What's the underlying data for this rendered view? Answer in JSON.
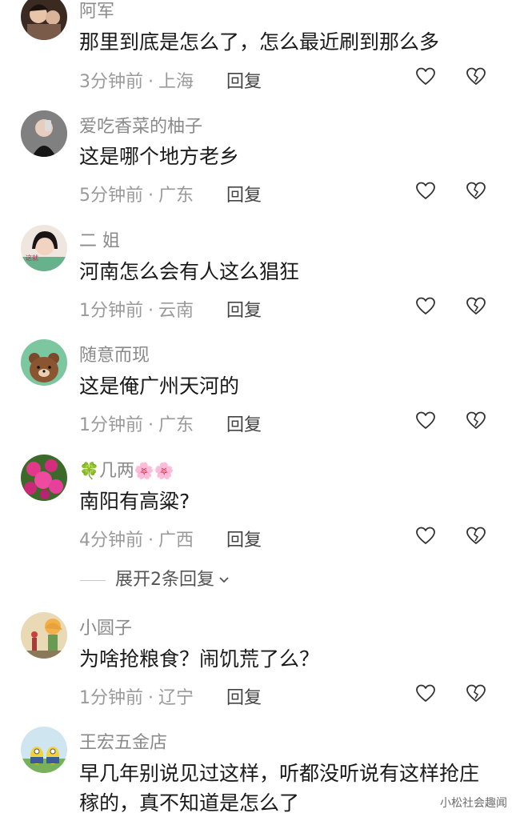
{
  "comments": [
    {
      "username": "阿军",
      "text": "那里到底是怎么了，怎么最近刷到那么多",
      "time": "3分钟前",
      "location": "上海",
      "reply_label": "回复"
    },
    {
      "username": "爱吃香菜的柚子",
      "text": "这是哪个地方老乡",
      "time": "5分钟前",
      "location": "广东",
      "reply_label": "回复"
    },
    {
      "username": "二  姐",
      "text": "河南怎么会有人这么猖狂",
      "time": "1分钟前",
      "location": "云南",
      "reply_label": "回复"
    },
    {
      "username": "随意而现",
      "text": "这是俺广州天河的",
      "time": "1分钟前",
      "location": "广东",
      "reply_label": "回复"
    },
    {
      "username": "几两",
      "text": "南阳有高粱?",
      "time": "4分钟前",
      "location": "广西",
      "reply_label": "回复"
    },
    {
      "username": "小圆子",
      "text": "为啥抢粮食？闹饥荒了么？",
      "time": "1分钟前",
      "location": "辽宁",
      "reply_label": "回复"
    },
    {
      "username": "王宏五金店",
      "text": "早几年别说见过这样，听都没听说有这样抢庄稼的，真不知道是怎么了",
      "time": "",
      "location": "",
      "reply_label": ""
    }
  ],
  "expand_replies_label": "展开2条回复",
  "separator_dot": "·",
  "emoji": {
    "clover": "🍀",
    "flower": "🌸"
  },
  "watermark": "小松社会趣闻",
  "colors": {
    "username": "#8a8a8a",
    "text": "#1a1a1a",
    "meta": "#9a9a9a",
    "icon_stroke": "#333333"
  }
}
